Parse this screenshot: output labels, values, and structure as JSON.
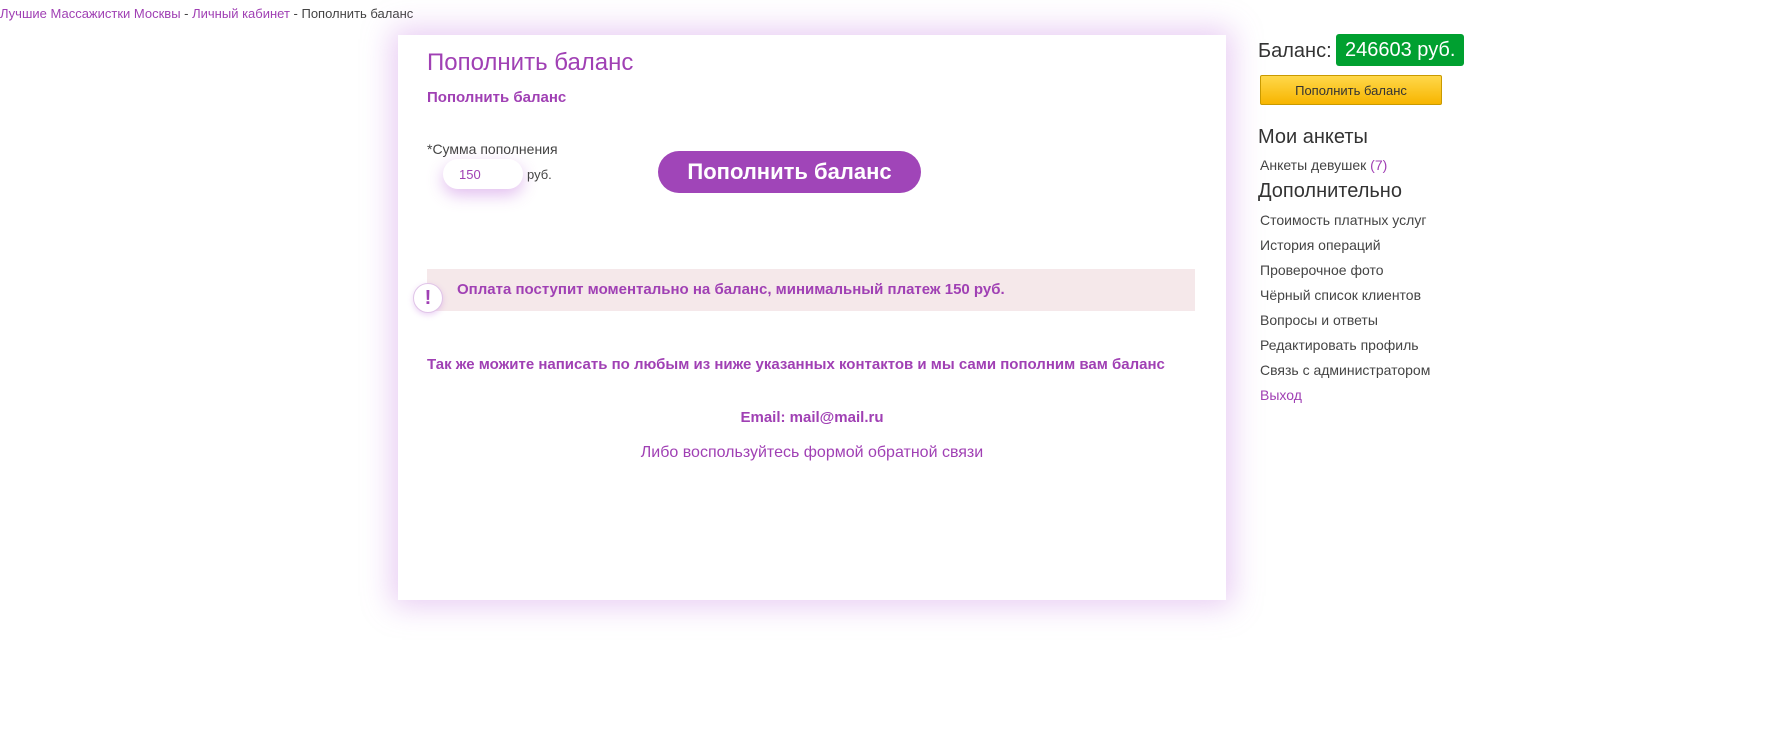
{
  "breadcrumb": {
    "home": "Лучшие Массажистки Москвы",
    "sep1": " - ",
    "cabinet": "Личный кабинет",
    "sep2": " - ",
    "current": "Пополнить баланс"
  },
  "card": {
    "title": "Пополнить баланс",
    "subtitle": "Пополнить баланс",
    "amount_label": "*Сумма пополнения",
    "amount_value": "150",
    "amount_unit": "руб.",
    "submit_label": "Пополнить баланс",
    "notice_icon": "!",
    "notice_text": "Оплата поступит моментально на баланс, минимальный платеж 150 руб.",
    "contacts_text": "Так же можите написать по любым из ниже указанных контактов и мы сами пополним вам баланс",
    "email_line": "Email: mail@mail.ru",
    "feedback_link": "Либо воспользуйтесь формой обратной связи"
  },
  "sidebar": {
    "balance_label": "Баланс:",
    "balance_value": "246603 руб.",
    "topup_label": "Пополнить баланс",
    "section_profiles": "Мои анкеты",
    "profiles_link": "Анкеты девушек",
    "profiles_count": "(7)",
    "section_extra": "Дополнительно",
    "links": [
      "Стоимость платных услуг",
      "История операций",
      "Проверочное фото",
      "Чёрный список клиентов",
      "Вопросы и ответы",
      "Редактировать профиль",
      "Связь с администратором"
    ],
    "exit": "Выход"
  },
  "colors": {
    "accent": "#a040b4",
    "balance_green": "#00a030",
    "topup_yellow": "#f7b500",
    "notice_bg": "#f5e8ea"
  },
  "icons": {
    "notice": "exclamation-icon"
  }
}
